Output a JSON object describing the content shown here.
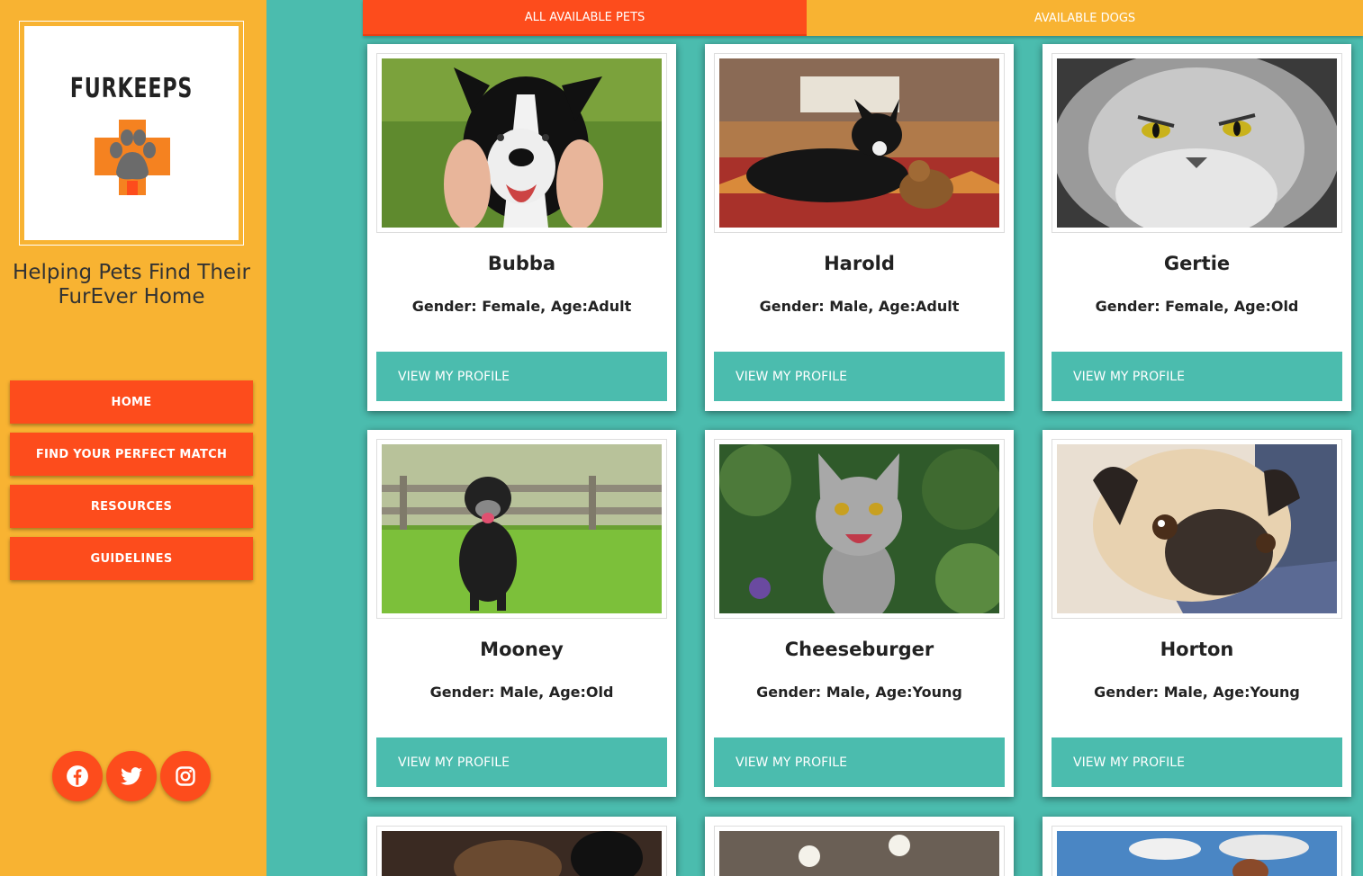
{
  "sidebar": {
    "logo_text": "FURKEEPS",
    "tagline": "Helping Pets Find Their FurEver Home",
    "nav": [
      {
        "label": "HOME"
      },
      {
        "label": "FIND YOUR PERFECT MATCH"
      },
      {
        "label": "RESOURCES"
      },
      {
        "label": "GUIDELINES"
      }
    ],
    "social": [
      "facebook-icon",
      "twitter-icon",
      "instagram-icon"
    ]
  },
  "tabs": [
    {
      "label": "ALL AVAILABLE PETS",
      "active": true
    },
    {
      "label": "AVAILABLE DOGS",
      "active": false
    }
  ],
  "pets": [
    {
      "name": "Bubba",
      "meta": "Gender: Female, Age:Adult",
      "button": "VIEW MY PROFILE",
      "photo": "border-collie-photo"
    },
    {
      "name": "Harold",
      "meta": "Gender: Male, Age:Adult",
      "button": "VIEW MY PROFILE",
      "photo": "black-dog-rug-photo"
    },
    {
      "name": "Gertie",
      "meta": "Gender: Female, Age:Old",
      "button": "VIEW MY PROFILE",
      "photo": "grumpy-persian-cat-photo"
    },
    {
      "name": "Mooney",
      "meta": "Gender: Male, Age:Old",
      "button": "VIEW MY PROFILE",
      "photo": "old-black-dog-grass-photo"
    },
    {
      "name": "Cheeseburger",
      "meta": "Gender: Male, Age:Young",
      "button": "VIEW MY PROFILE",
      "photo": "tabby-kitten-photo"
    },
    {
      "name": "Horton",
      "meta": "Gender: Male, Age:Young",
      "button": "VIEW MY PROFILE",
      "photo": "pug-photo"
    }
  ],
  "colors": {
    "sidebar_bg": "#f8b332",
    "accent": "#fd4c1c",
    "teal": "#4bbcae"
  }
}
